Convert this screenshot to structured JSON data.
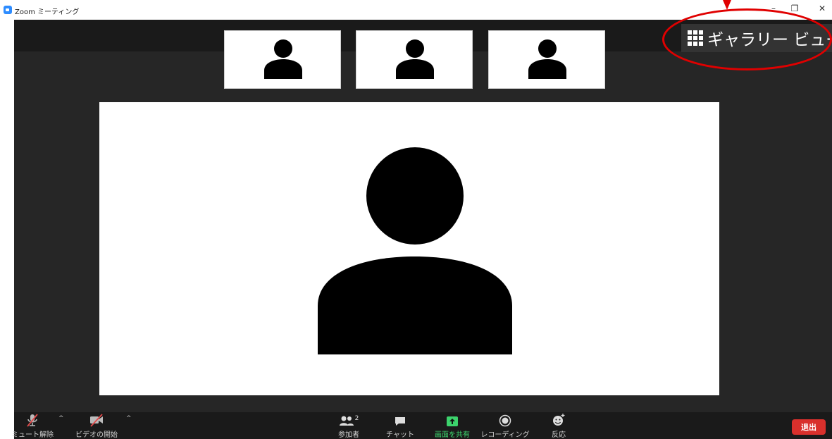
{
  "window": {
    "title": "Zoom ミーティング",
    "minimize_glyph": "–",
    "restore_glyph": "❐",
    "close_glyph": "✕"
  },
  "view_button": {
    "label": "ギャラリー ビュー",
    "icon": "grid-icon"
  },
  "annotation": {
    "color": "#e00000"
  },
  "participants": {
    "thumbnails": [
      "person-icon",
      "person-icon",
      "person-icon"
    ],
    "active_speaker": "person-icon"
  },
  "toolbar": {
    "unmute_label": "ミュート解除",
    "start_video_label": "ビデオの開始",
    "participants_label": "参加者",
    "participants_count": "2",
    "chat_label": "チャット",
    "share_screen_label": "画面を共有",
    "record_label": "レコーディング",
    "reactions_label": "反応",
    "leave_label": "退出"
  },
  "colors": {
    "meeting_bg": "#262626",
    "toolbar_bg": "#1a1a1a",
    "share_green": "#3cd36c",
    "leave_red": "#d9302c",
    "muted_slash": "#e24a4a"
  }
}
